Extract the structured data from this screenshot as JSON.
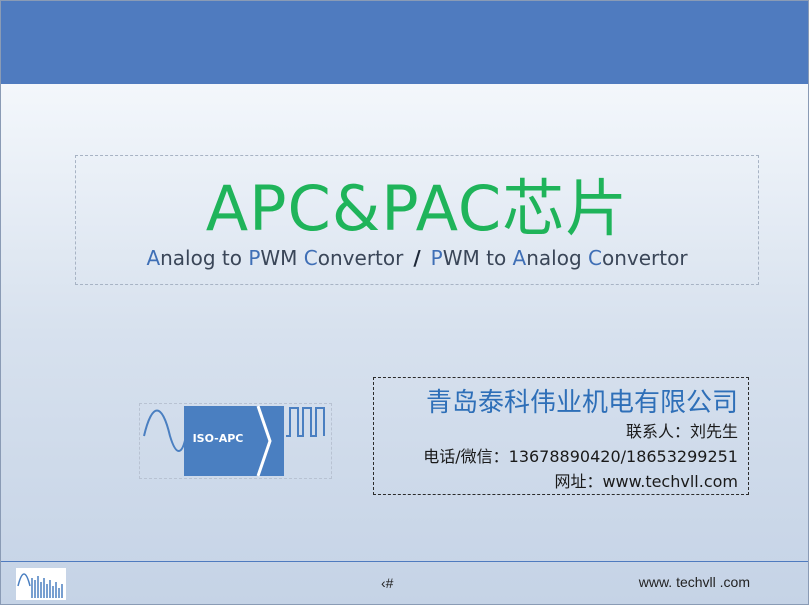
{
  "slide": {
    "title": "APC&PAC芯片",
    "subtitle": {
      "left": [
        {
          "cap": "A",
          "rest": "nalog to "
        },
        {
          "cap": "P",
          "rest": "WM "
        },
        {
          "cap": "C",
          "rest": "onvertor"
        }
      ],
      "separator": "/",
      "right": [
        {
          "cap": "P",
          "rest": "WM to  "
        },
        {
          "cap": "A",
          "rest": "nalog "
        },
        {
          "cap": "C",
          "rest": "onvertor"
        }
      ]
    },
    "logo_label": "ISO-APC",
    "contact": {
      "company": "青岛泰科伟业机电有限公司",
      "person": "联系人：刘先生",
      "phone": "电话/微信：13678890420/18653299251",
      "website": "网址：www.techvll.com"
    },
    "footer": {
      "page_number": "‹#",
      "website": "www. techvll .com"
    }
  },
  "colors": {
    "top_band": "#4f7bbf",
    "title_green": "#1fb45a",
    "company_blue": "#2e6fb8",
    "logo_blue": "#4a7fc1"
  }
}
